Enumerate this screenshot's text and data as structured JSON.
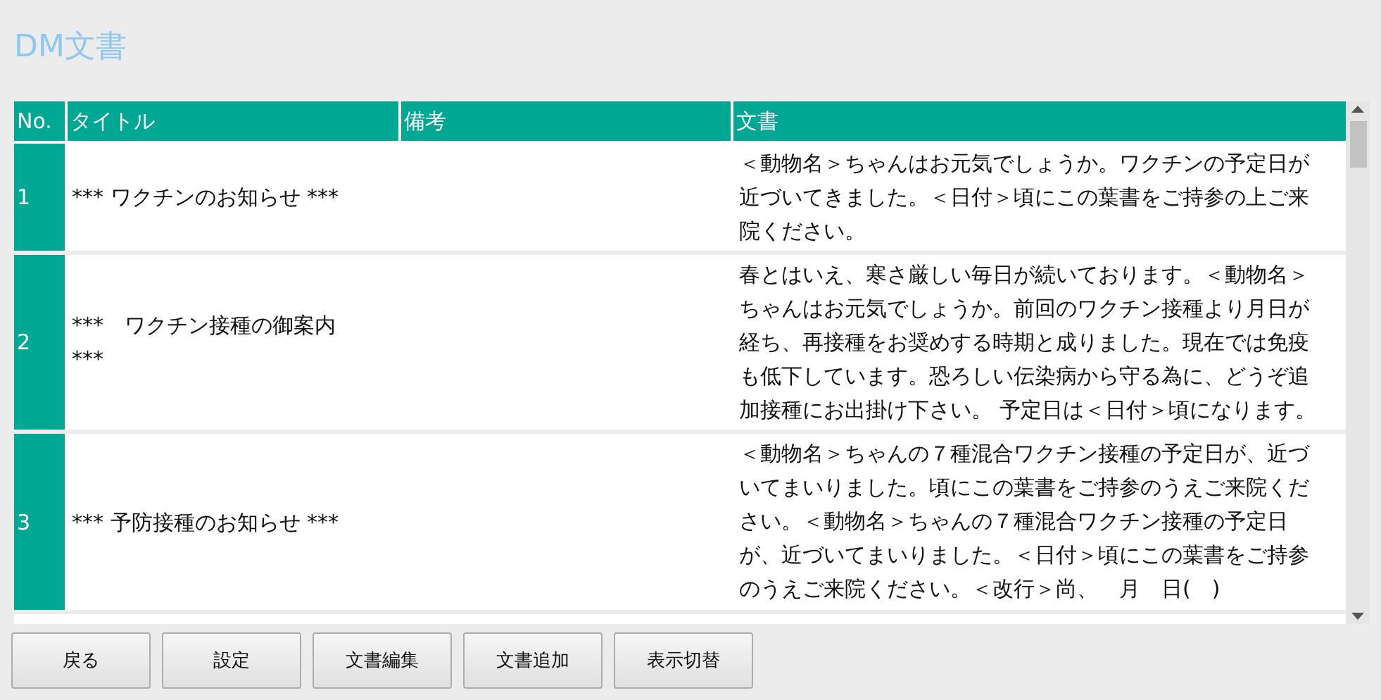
{
  "page_title": "DM文書",
  "table": {
    "columns": [
      "No.",
      "タイトル",
      "備考",
      "文書"
    ],
    "rows": [
      {
        "no": "1",
        "title": "*** ワクチンのお知らせ ***",
        "note": "",
        "document": "＜動物名＞ちゃんはお元気でしょうか。ワクチンの予定日が近づいてきました。＜日付＞頃にこの葉書をご持参の上ご来院ください。"
      },
      {
        "no": "2",
        "title": "***　ワクチン接種の御案内\n***",
        "note": "",
        "document": "春とはいえ、寒さ厳しい毎日が続いております。＜動物名＞ちゃんはお元気でしょうか。前回のワクチン接種より月日が経ち、再接種をお奨めする時期と成りました。現在では免疫も低下しています。恐ろしい伝染病から守る為に、どうぞ追加接種にお出掛け下さい。 予定日は＜日付＞頃になります。"
      },
      {
        "no": "3",
        "title": "*** 予防接種のお知らせ ***",
        "note": "",
        "document": "＜動物名＞ちゃんの７種混合ワクチン接種の予定日が、近づいてまいりました。頃にこの葉書をご持参のうえご来院ください。＜動物名＞ちゃんの７種混合ワクチン接種の予定日が、近づいてまいりました。＜日付＞頃にこの葉書をご持参のうえご来院ください。＜改行＞尚、　月　日(　)"
      }
    ]
  },
  "buttons": [
    "戻る",
    "設定",
    "文書編集",
    "文書追加",
    "表示切替"
  ]
}
